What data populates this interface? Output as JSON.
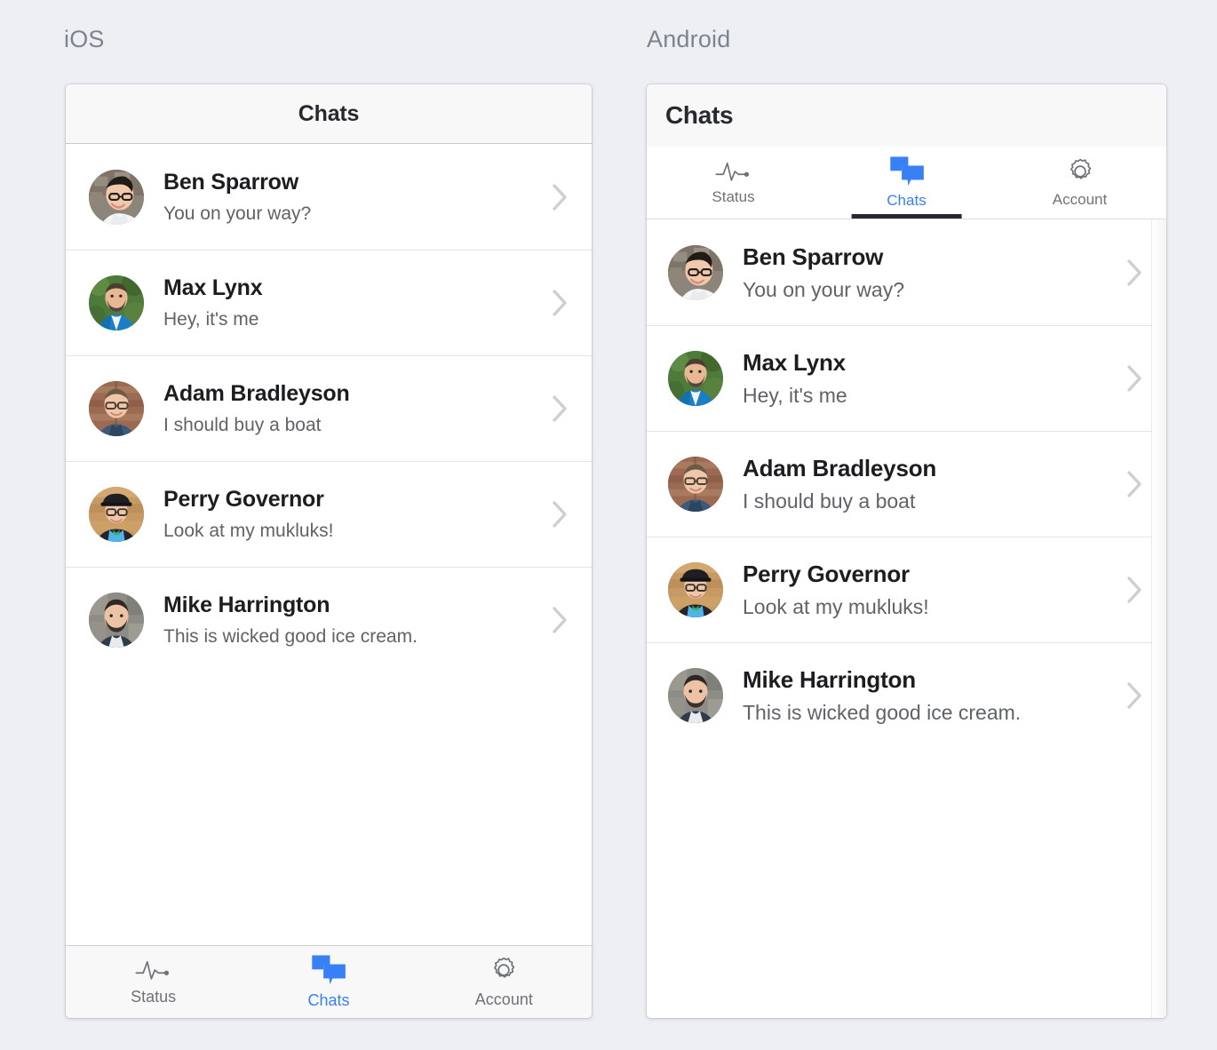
{
  "platforms": {
    "ios_label": "iOS",
    "android_label": "Android"
  },
  "ios": {
    "header_title": "Chats",
    "tabbar": [
      {
        "label": "Status",
        "icon": "pulse-icon",
        "active": false
      },
      {
        "label": "Chats",
        "icon": "chat-bubbles-icon",
        "active": true
      },
      {
        "label": "Account",
        "icon": "gear-icon",
        "active": false
      }
    ]
  },
  "android": {
    "header_title": "Chats",
    "tabs": [
      {
        "label": "Status",
        "icon": "pulse-icon",
        "active": false
      },
      {
        "label": "Chats",
        "icon": "chat-bubbles-icon",
        "active": true
      },
      {
        "label": "Account",
        "icon": "gear-icon",
        "active": false
      }
    ]
  },
  "chats": [
    {
      "name": "Ben Sparrow",
      "message": "You on your way?",
      "avatar": "ben-sparrow-avatar"
    },
    {
      "name": "Max Lynx",
      "message": "Hey, it's me",
      "avatar": "max-lynx-avatar"
    },
    {
      "name": "Adam Bradleyson",
      "message": "I should buy a boat",
      "avatar": "adam-bradleyson-avatar"
    },
    {
      "name": "Perry Governor",
      "message": "Look at my mukluks!",
      "avatar": "perry-governor-avatar"
    },
    {
      "name": "Mike Harrington",
      "message": "This is wicked good ice cream.",
      "avatar": "mike-harrington-avatar"
    }
  ],
  "colors": {
    "accent_blue": "#3880f5",
    "page_background": "#edeff3",
    "header_background": "#f8f8f8",
    "text_primary": "#1b1d20",
    "text_secondary": "#5f6368",
    "chevron": "#c6c7ca"
  },
  "chevron_icon": "chevron-right-icon"
}
